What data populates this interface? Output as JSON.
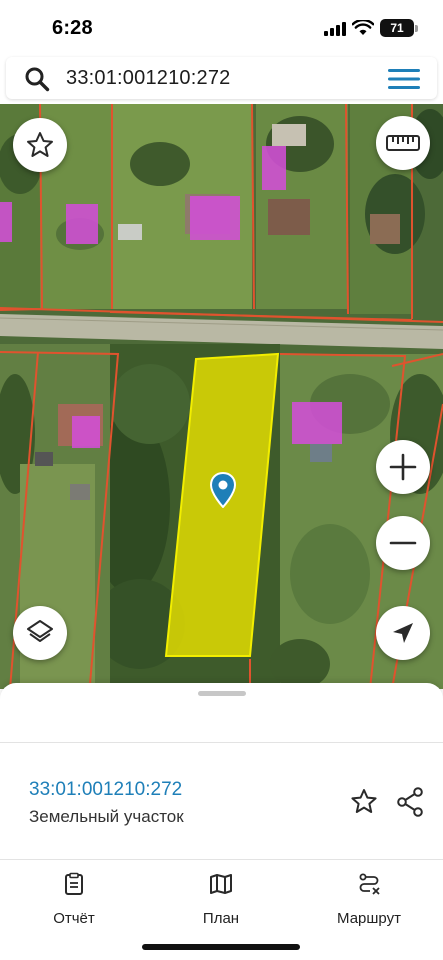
{
  "status": {
    "time": "6:28",
    "battery": "71"
  },
  "search": {
    "value": "33:01:001210:272"
  },
  "map": {
    "selected_parcel_color": "#e8e200",
    "parcel_border_color": "#e0532e",
    "building_color": "#d24fd6",
    "buttons": [
      "favorite",
      "ruler",
      "layers",
      "zoom-in",
      "zoom-out",
      "my-location"
    ]
  },
  "sheet": {
    "parcel_id": "33:01:001210:272",
    "parcel_type": "Земельный участок"
  },
  "tabs": [
    {
      "label": "Отчёт",
      "icon": "report-icon"
    },
    {
      "label": "План",
      "icon": "map-plan-icon"
    },
    {
      "label": "Маршрут",
      "icon": "route-icon"
    }
  ]
}
